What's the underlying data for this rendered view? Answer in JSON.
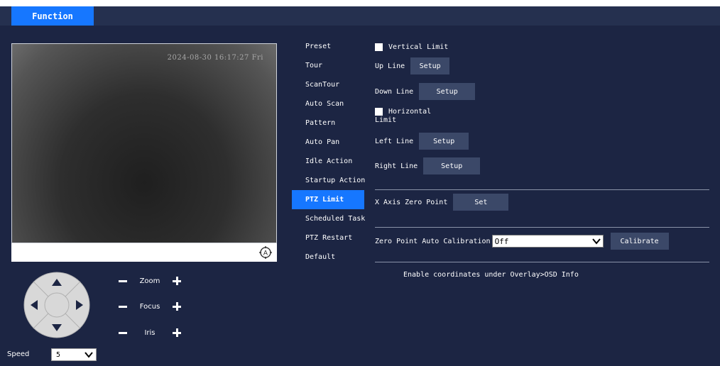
{
  "top_tab": {
    "label": "Function"
  },
  "video": {
    "timestamp": "2024-08-30 16:17:27 Fri"
  },
  "lens": {
    "zoom": "Zoom",
    "focus": "Focus",
    "iris": "Iris"
  },
  "speed": {
    "label": "Speed",
    "value": "5"
  },
  "menu": [
    {
      "label": "Preset"
    },
    {
      "label": "Tour"
    },
    {
      "label": "ScanTour"
    },
    {
      "label": "Auto Scan"
    },
    {
      "label": "Pattern"
    },
    {
      "label": "Auto Pan"
    },
    {
      "label": "Idle Action"
    },
    {
      "label": "Startup Action"
    },
    {
      "label": "PTZ Limit",
      "active": true
    },
    {
      "label": "Scheduled Task"
    },
    {
      "label": "PTZ Restart"
    },
    {
      "label": "Default"
    }
  ],
  "panel": {
    "vertical_limit": "Vertical Limit",
    "up_line": "Up Line",
    "down_line": "Down Line",
    "horizontal_limit_1": "Horizontal",
    "horizontal_limit_2": "Limit",
    "left_line": "Left Line",
    "right_line": "Right Line",
    "setup": "Setup",
    "x_axis_zero": "X Axis Zero Point",
    "set": "Set",
    "zero_point_auto_cal": "Zero Point Auto Calibration",
    "zero_point_value": "Off",
    "calibrate": "Calibrate",
    "note": "Enable coordinates under Overlay>OSD Info"
  },
  "colors": {
    "accent": "#1677ff",
    "background": "#1c2543",
    "button": "#3b4868"
  }
}
